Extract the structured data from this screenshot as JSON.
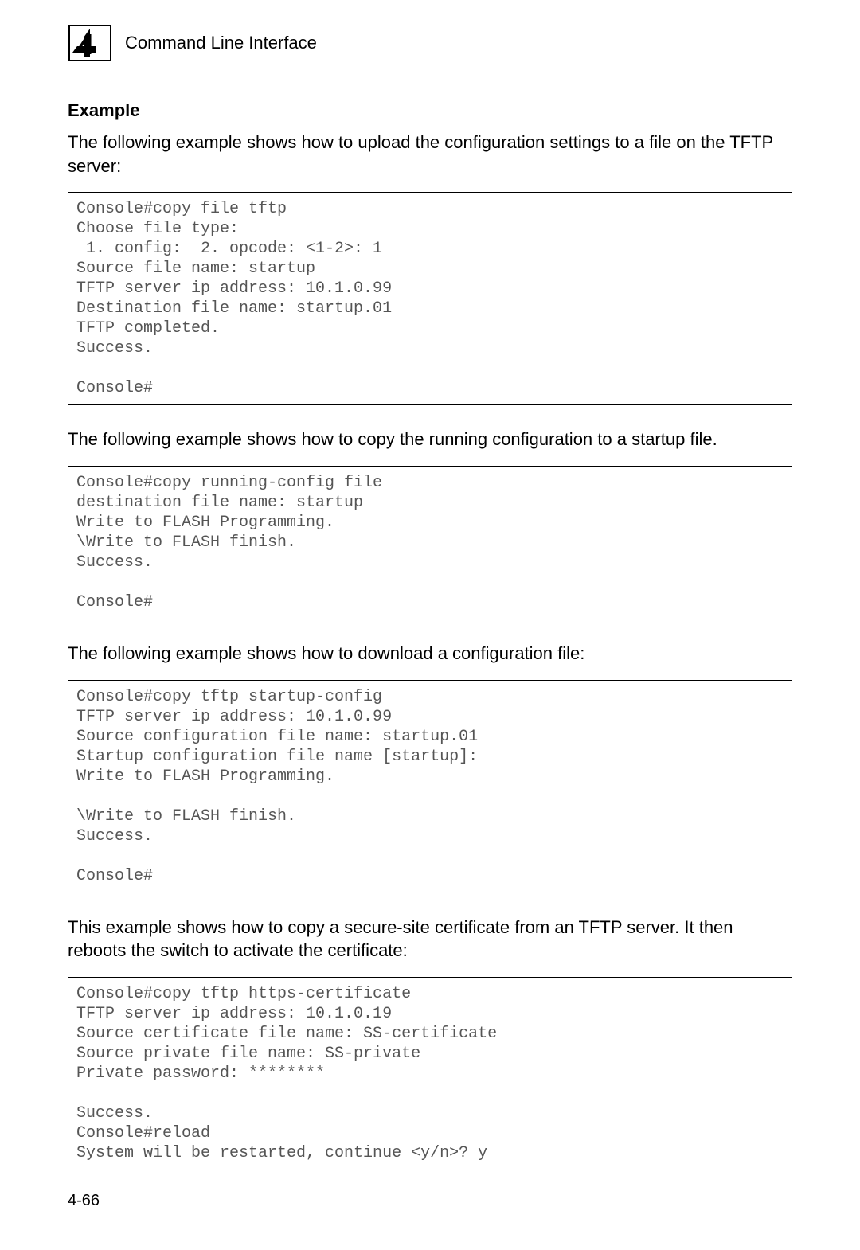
{
  "header": {
    "chapter_number": "4",
    "title": "Command Line Interface"
  },
  "sections": {
    "example_heading": "Example",
    "intro1": "The following example shows how to upload the configuration settings to a file on the TFTP server:",
    "code1": "Console#copy file tftp\nChoose file type:\n 1. config:  2. opcode: <1-2>: 1\nSource file name: startup\nTFTP server ip address: 10.1.0.99\nDestination file name: startup.01\nTFTP completed.\nSuccess.\n\nConsole#",
    "intro2": "The following example shows how to copy the running configuration to a startup file.",
    "code2": "Console#copy running-config file\ndestination file name: startup\nWrite to FLASH Programming.\n\\Write to FLASH finish.\nSuccess.\n\nConsole#",
    "intro3": "The following example shows how to download a configuration file:",
    "code3": "Console#copy tftp startup-config\nTFTP server ip address: 10.1.0.99\nSource configuration file name: startup.01\nStartup configuration file name [startup]:\nWrite to FLASH Programming.\n\n\\Write to FLASH finish.\nSuccess.\n\nConsole#",
    "intro4": "This example shows how to copy a secure-site certificate from an TFTP server. It then reboots the switch to activate the certificate:",
    "code4": "Console#copy tftp https-certificate\nTFTP server ip address: 10.1.0.19\nSource certificate file name: SS-certificate\nSource private file name: SS-private\nPrivate password: ********\n\nSuccess.\nConsole#reload\nSystem will be restarted, continue <y/n>? y"
  },
  "footer": {
    "page_number": "4-66"
  }
}
